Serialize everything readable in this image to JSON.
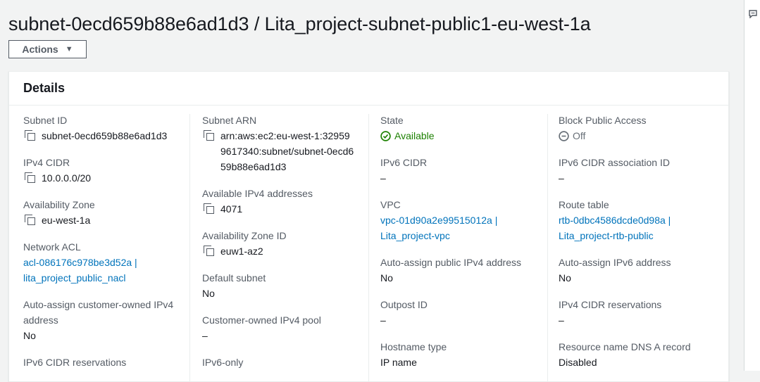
{
  "page": {
    "title": "subnet-0ecd659b88e6ad1d3 / Lita_project-subnet-public1-eu-west-1a",
    "actions_label": "Actions"
  },
  "details": {
    "heading": "Details",
    "col1": {
      "subnet_id_label": "Subnet ID",
      "subnet_id": "subnet-0ecd659b88e6ad1d3",
      "ipv4_cidr_label": "IPv4 CIDR",
      "ipv4_cidr": "10.0.0.0/20",
      "az_label": "Availability Zone",
      "az": "eu-west-1a",
      "nacl_label": "Network ACL",
      "nacl": "acl-086176c978be3d52a | lita_project_public_nacl",
      "auto_coip_label": "Auto-assign customer-owned IPv4 address",
      "auto_coip": "No",
      "ipv6_cidr_res_label": "IPv6 CIDR reservations"
    },
    "col2": {
      "arn_label": "Subnet ARN",
      "arn": "arn:aws:ec2:eu-west-1:329599617340:subnet/subnet-0ecd659b88e6ad1d3",
      "avail_ipv4_label": "Available IPv4 addresses",
      "avail_ipv4": "4071",
      "az_id_label": "Availability Zone ID",
      "az_id": "euw1-az2",
      "default_subnet_label": "Default subnet",
      "default_subnet": "No",
      "coip_pool_label": "Customer-owned IPv4 pool",
      "coip_pool": "–",
      "ipv6_only_label": "IPv6-only"
    },
    "col3": {
      "state_label": "State",
      "state": "Available",
      "ipv6_cidr_label": "IPv6 CIDR",
      "ipv6_cidr": "–",
      "vpc_label": "VPC",
      "vpc": "vpc-01d90a2e99515012a | Lita_project-vpc",
      "auto_public_ipv4_label": "Auto-assign public IPv4 address",
      "auto_public_ipv4": "No",
      "outpost_label": "Outpost ID",
      "outpost": "–",
      "hostname_type_label": "Hostname type",
      "hostname_type": "IP name"
    },
    "col4": {
      "bpa_label": "Block Public Access",
      "bpa": "Off",
      "ipv6_assoc_label": "IPv6 CIDR association ID",
      "ipv6_assoc": "–",
      "route_table_label": "Route table",
      "route_table": "rtb-0dbc4586dcde0d98a | Lita_project-rtb-public",
      "auto_ipv6_label": "Auto-assign IPv6 address",
      "auto_ipv6": "No",
      "ipv4_cidr_res_label": "IPv4 CIDR reservations",
      "ipv4_cidr_res": "–",
      "dns_a_label": "Resource name DNS A record",
      "dns_a": "Disabled"
    }
  },
  "colors": {
    "link": "#0073bb",
    "success": "#1d8102",
    "muted": "#687078"
  }
}
